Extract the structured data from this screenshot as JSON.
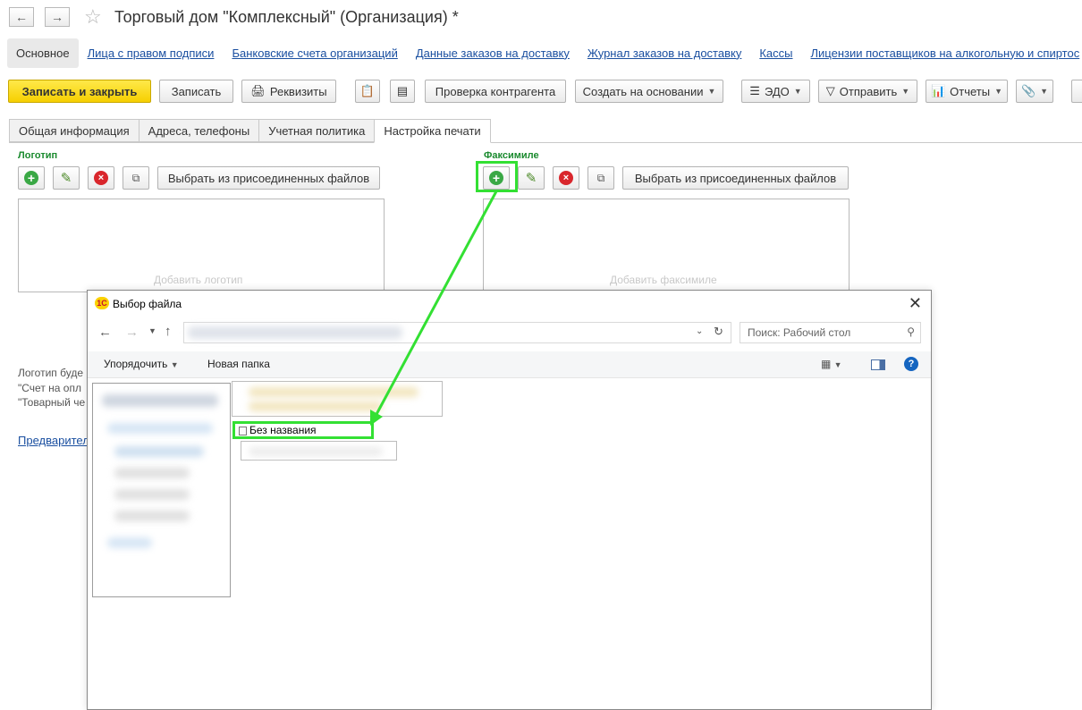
{
  "window": {
    "title": "Торговый дом \"Комплексный\" (Организация) *"
  },
  "sections": {
    "active": "Основное",
    "links": [
      "Лица с правом подписи",
      "Банковские счета организаций",
      "Данные заказов на доставку",
      "Журнал заказов на доставку",
      "Кассы",
      "Лицензии поставщиков на алкогольную и спиртос"
    ]
  },
  "toolbar": {
    "save_close": "Записать и закрыть",
    "save": "Записать",
    "details": "Реквизиты",
    "check_counterparty": "Проверка контрагента",
    "create_based_on": "Создать на основании",
    "edo": "ЭДО",
    "send": "Отправить",
    "reports": "Отчеты"
  },
  "tabs": [
    "Общая информация",
    "Адреса, телефоны",
    "Учетная политика",
    "Настройка печати"
  ],
  "logo_group": {
    "title": "Логотип",
    "select_button": "Выбрать из присоединенных файлов",
    "placeholder": "Добавить логотип",
    "note_line1": "Логотип буде",
    "note_line2": "\"Счет на опл",
    "note_line3": "\"Товарный че",
    "preview_link": "Предварител"
  },
  "facsimile_group": {
    "title": "Факсимиле",
    "select_button": "Выбрать  из присоединенных файлов",
    "placeholder": "Добавить факсимиле"
  },
  "dialog": {
    "logo_text": "1С",
    "title": "Выбор файла",
    "search_placeholder": "Поиск: Рабочий стол",
    "organize": "Упорядочить",
    "new_folder": "Новая папка",
    "selected_file": "Без названия"
  },
  "colors": {
    "accent_yellow": "#f6cf00",
    "highlight_green": "#33e033",
    "link_blue": "#1a4fa0",
    "group_title_green": "#1a8a2e"
  }
}
